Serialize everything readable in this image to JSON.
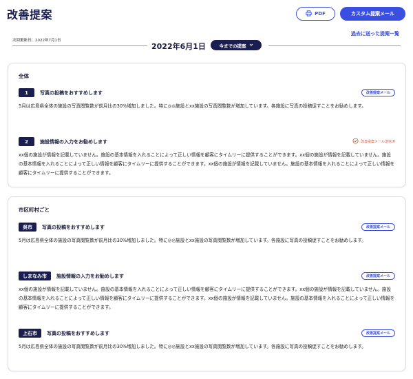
{
  "header": {
    "title": "改善提案",
    "pdf_label": "PDF",
    "mail_label": "カスタム提案メール",
    "history_link": "過去に送った提案一覧",
    "updated": "次回更新日：2022年7月1日",
    "date": "2022年6月1日",
    "period_select": "今までの提案"
  },
  "overall": {
    "title": "全体",
    "items": [
      {
        "tag": "1",
        "title": "写真の投稿をおすすめします",
        "action": "改善提案メール",
        "body": "5月は広島県全体の施設の写真閲覧数が前月比の30%増加しました。特に◎◎施設とxx施設の写真閲覧数が増加しています。各施設に写真の投稿促すことをお勧めします。"
      },
      {
        "tag": "2",
        "title": "施設情報の入力をお勧めします",
        "action": "改善提案メール送信済",
        "body": "xx個の施設が情報を記載していません。施設の基本情報を入れることによって正しい情報を顧客にタイムリーに提供することができます。xx個の施設が情報を記載していません。施設の基本情報を入れることによって正しい情報を顧客にタイムリーに提供することができます。xx個の施設が情報を記載していません。施設の基本情報を入れることによって正しい情報を顧客にタイムリーに提供することができます。"
      }
    ]
  },
  "municipal": {
    "title": "市区町村ごと",
    "items": [
      {
        "tag": "呉市",
        "title": "写真の投稿をおすすめします",
        "action": "改善提案メール",
        "body": "5月は広島県全体の施設の写真閲覧数が前月比の30%増加しました。特に◎◎施設とxx施設の写真閲覧数が増加しています。各施設に写真の投稿促すことをお勧めします。"
      },
      {
        "tag": "しまなみ市",
        "title": "施設情報の入力をお勧めします",
        "action": "改善提案メール",
        "body": "xx個の施設が情報を記載していません。施設の基本情報を入れることによって正しい情報を顧客にタイムリーに提供することができます。xx個の施設が情報を記載していません。施設の基本情報を入れることによって正しい情報を顧客にタイムリーに提供することができます。xx個の施設が情報を記載していません。施設の基本情報を入れることによって正しい情報を顧客にタイムリーに提供することができます。"
      },
      {
        "tag": "上石市",
        "title": "写真の投稿をおすすめします",
        "action": "改善提案メール",
        "body": "5月は広島県全体の施設の写真閲覧数が前月比の30%増加しました。特に◎◎施設とxx施設の写真閲覧数が増加しています。各施設に写真の投稿促すことをお勧めします。"
      }
    ]
  }
}
